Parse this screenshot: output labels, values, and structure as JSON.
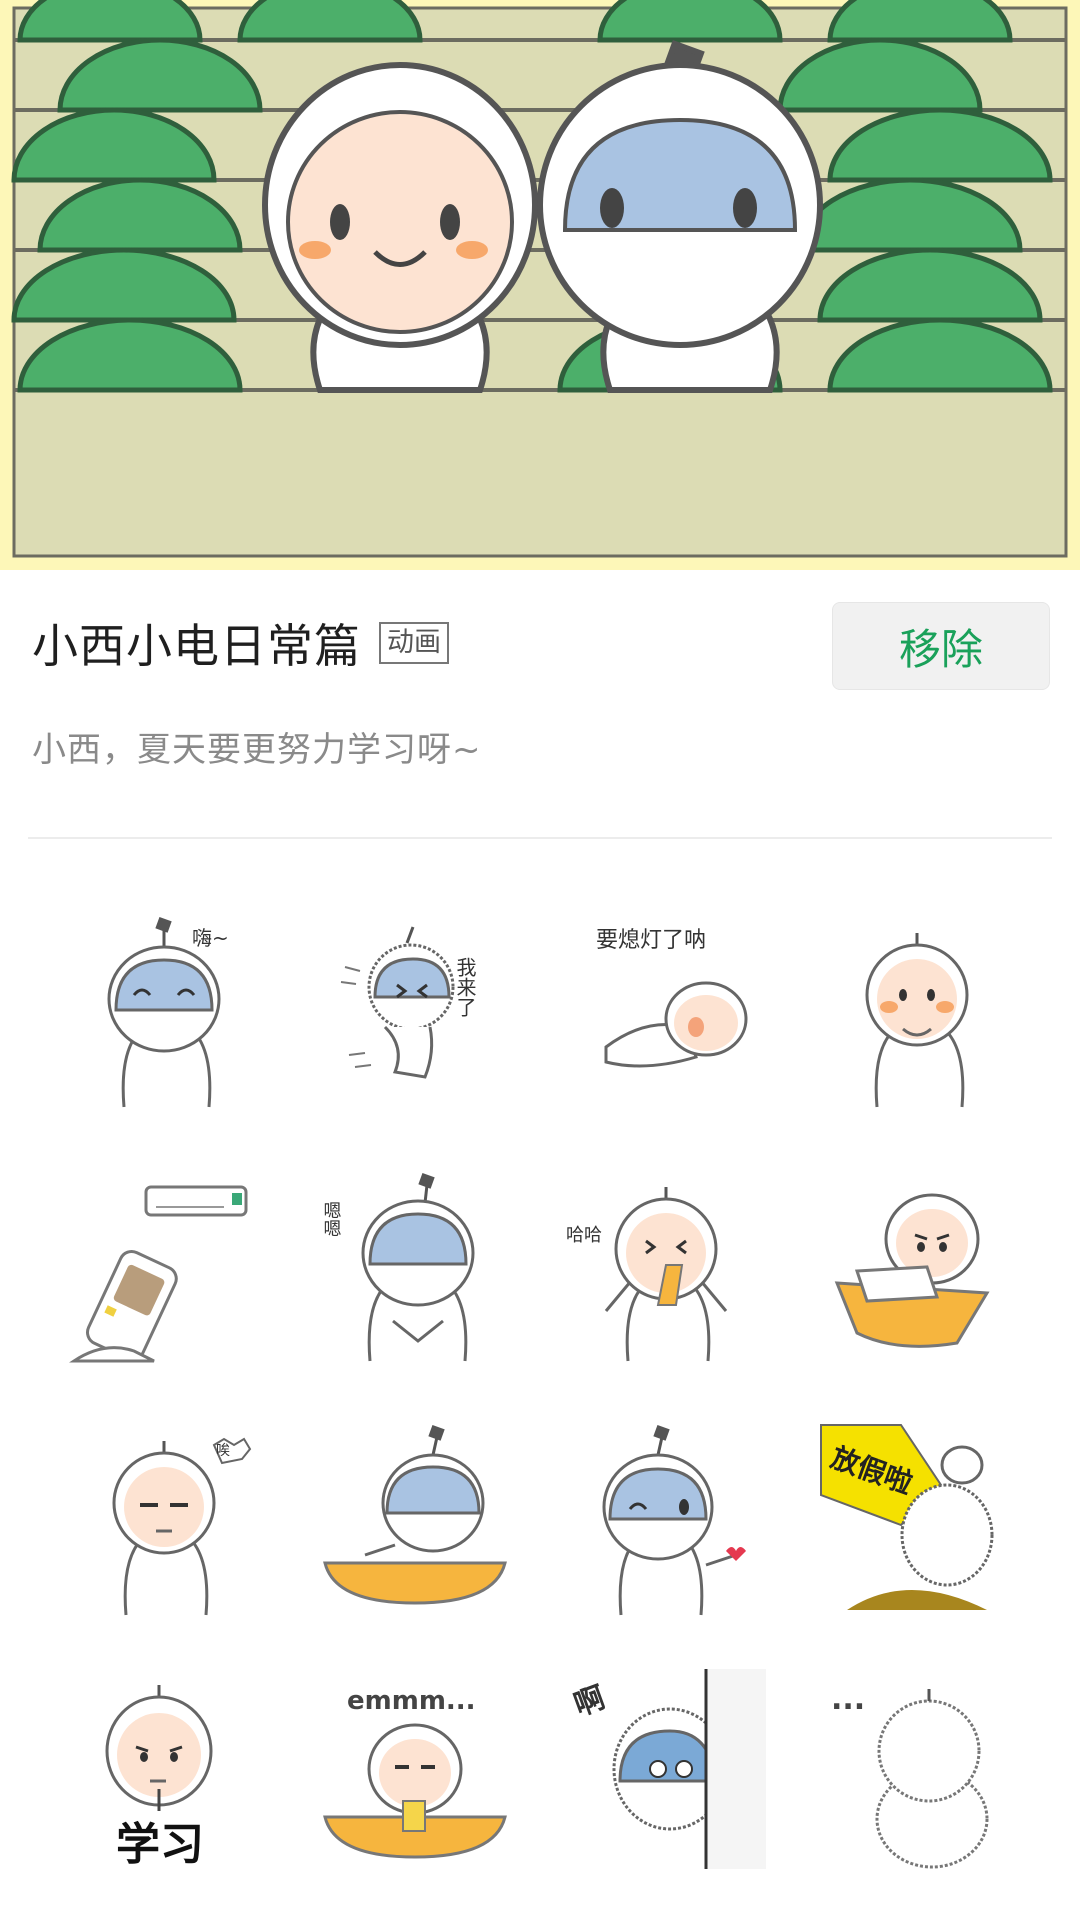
{
  "pack": {
    "title": "小西小电日常篇",
    "tag": "动画",
    "remove_label": "移除",
    "description": "小西，夏天要更努力学习呀~"
  },
  "colors": {
    "accent_green": "#1aa15a",
    "banner_border": "#fdf7b8",
    "leaf_green": "#4caf6a",
    "visor_blue": "#a9c3e2",
    "face_peach": "#fde3d2"
  },
  "stickers": [
    {
      "icon": "xiaodian-hi-sticker",
      "caption": "嗨~"
    },
    {
      "icon": "xiaodian-running-sticker",
      "caption": "我来了"
    },
    {
      "icon": "xiaoxi-sleeping-sticker",
      "caption": "要熄灯了呐"
    },
    {
      "icon": "xiaoxi-shy-sticker",
      "caption": ""
    },
    {
      "icon": "air-conditioner-remote-sticker",
      "caption": ""
    },
    {
      "icon": "xiaodian-hmm-sticker",
      "caption": "嗯嗯"
    },
    {
      "icon": "xiaoxi-laughing-sticker",
      "caption": "哈哈"
    },
    {
      "icon": "xiaoxi-laptop-sticker",
      "caption": ""
    },
    {
      "icon": "xiaoxi-sigh-sticker",
      "caption": "唉"
    },
    {
      "icon": "xiaodian-desk-sticker",
      "caption": ""
    },
    {
      "icon": "xiaodian-heart-sticker",
      "caption": ""
    },
    {
      "icon": "vacation-flag-sticker",
      "caption": "放假啦"
    },
    {
      "icon": "xiaoxi-study-sticker",
      "caption": "学习"
    },
    {
      "icon": "xiaoxi-emmm-sticker",
      "caption": "emmm..."
    },
    {
      "icon": "xiaodian-peek-sticker",
      "caption": "啊"
    },
    {
      "icon": "xiaoxi-back-sticker",
      "caption": "..."
    }
  ]
}
